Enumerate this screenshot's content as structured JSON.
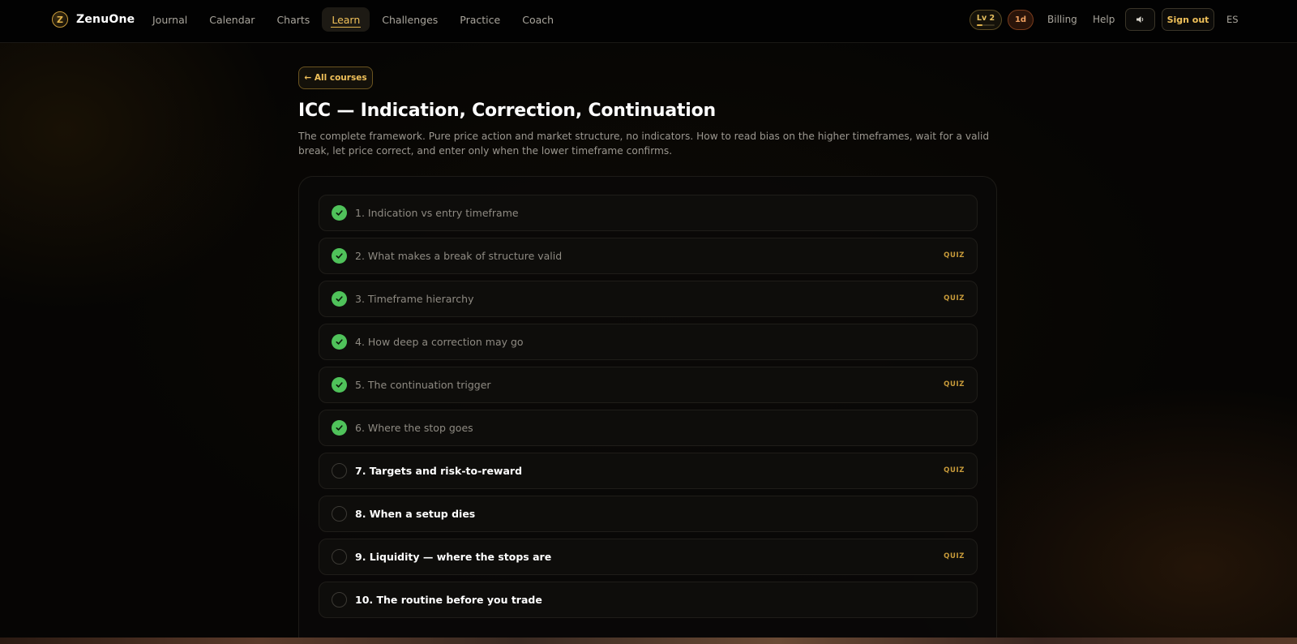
{
  "brand": {
    "name": "ZenuOne",
    "logo_letter": "Z"
  },
  "nav": [
    {
      "label": "Journal",
      "active": false
    },
    {
      "label": "Calendar",
      "active": false
    },
    {
      "label": "Charts",
      "active": false
    },
    {
      "label": "Learn",
      "active": true
    },
    {
      "label": "Challenges",
      "active": false
    },
    {
      "label": "Practice",
      "active": false
    },
    {
      "label": "Coach",
      "active": false
    }
  ],
  "header": {
    "level_label": "Lv 2",
    "level_progress": 0.3,
    "streak_label": "1d",
    "billing_label": "Billing",
    "help_label": "Help",
    "sound_icon": "speaker-icon",
    "signout_label": "Sign out",
    "lang_label": "ES"
  },
  "course": {
    "back_label": "← All courses",
    "title": "ICC — Indication, Correction, Continuation",
    "description": "The complete framework. Pure price action and market structure, no indicators. How to read bias on the higher timeframes, wait for a valid break, let price correct, and enter only when the lower timeframe confirms.",
    "lessons": [
      {
        "label": "1. Indication vs entry timeframe",
        "done": true,
        "quiz": ""
      },
      {
        "label": "2. What makes a break of structure valid",
        "done": true,
        "quiz": "QUIZ"
      },
      {
        "label": "3. Timeframe hierarchy",
        "done": true,
        "quiz": "QUIZ"
      },
      {
        "label": "4. How deep a correction may go",
        "done": true,
        "quiz": ""
      },
      {
        "label": "5. The continuation trigger",
        "done": true,
        "quiz": "QUIZ"
      },
      {
        "label": "6. Where the stop goes",
        "done": true,
        "quiz": ""
      },
      {
        "label": "7. Targets and risk-to-reward",
        "done": false,
        "quiz": "QUIZ"
      },
      {
        "label": "8. When a setup dies",
        "done": false,
        "quiz": ""
      },
      {
        "label": "9. Liquidity — where the stops are",
        "done": false,
        "quiz": "QUIZ"
      },
      {
        "label": "10. The routine before you trade",
        "done": false,
        "quiz": ""
      }
    ]
  },
  "colors": {
    "accent": "#f0c15a",
    "done_green": "#4fc25a",
    "background": "#060504"
  }
}
